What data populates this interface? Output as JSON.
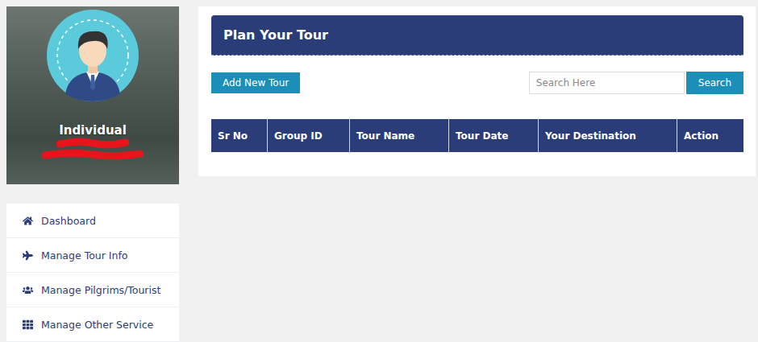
{
  "profile": {
    "role": "Individual"
  },
  "sidebar": {
    "items": [
      {
        "label": "Dashboard",
        "selected": false
      },
      {
        "label": "Manage Tour Info",
        "selected": false
      },
      {
        "label": "Manage Pilgrims/Tourist",
        "selected": false
      },
      {
        "label": "Manage Other Service",
        "selected": false
      }
    ]
  },
  "panel": {
    "title": "Plan Your Tour"
  },
  "toolbar": {
    "add_button": "Add New Tour",
    "search": {
      "placeholder": "Search Here",
      "button": "Search"
    }
  },
  "table": {
    "columns": [
      "Sr No",
      "Group ID",
      "Tour Name",
      "Tour Date",
      "Your Destination",
      "Action"
    ],
    "rows": []
  }
}
